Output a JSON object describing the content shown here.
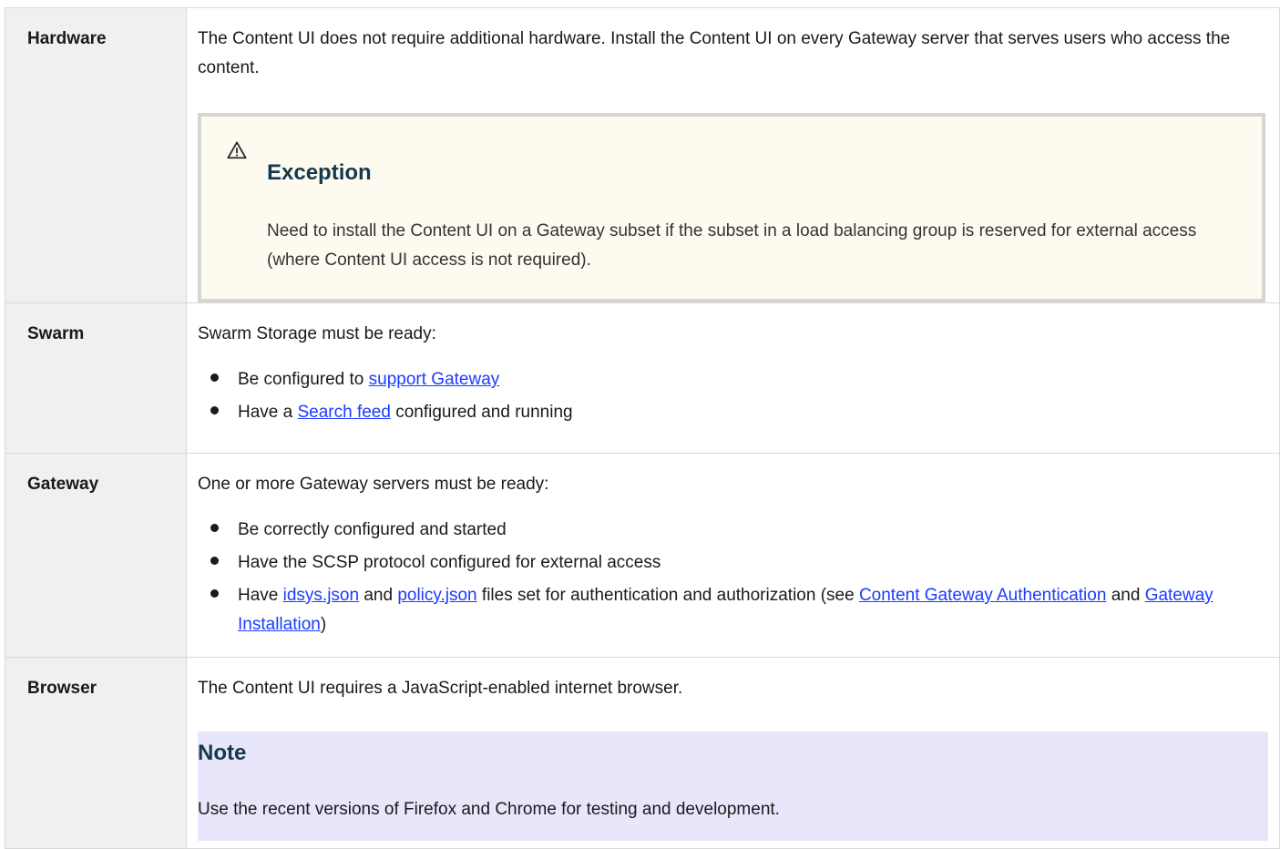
{
  "rows": [
    {
      "label": "Hardware",
      "text": "The Content UI does not require additional hardware. Install the Content UI on every Gateway server that serves users who access the content.",
      "callout": {
        "icon": "warning-icon",
        "title": "Exception",
        "body": "Need to install the Content UI on a Gateway subset if the subset in a load balancing group is reserved for external access (where Content UI access is not required)."
      }
    },
    {
      "label": "Swarm",
      "intro": "Swarm Storage must be ready:",
      "bullets": [
        {
          "pre": "Be configured to ",
          "link": "support Gateway",
          "post": ""
        },
        {
          "pre": "Have a ",
          "link": "Search feed",
          "post": " configured and running"
        }
      ]
    },
    {
      "label": "Gateway",
      "intro": "One or more Gateway servers must be ready:",
      "bullets": [
        {
          "text": "Be correctly configured and started"
        },
        {
          "text": "Have the SCSP protocol configured for external access"
        },
        {
          "pre": "Have ",
          "link1": "idsys.json",
          "mid1": " and ",
          "link2": "policy.json",
          "mid2": " files set for authentication and authorization (see ",
          "link3": "Content Gateway Authentication",
          "mid3": " and ",
          "link4": "Gateway Installation",
          "post": ")"
        }
      ]
    },
    {
      "label": "Browser",
      "text": "The Content UI requires a JavaScript-enabled internet browser.",
      "note": {
        "title": "Note",
        "body": "Use the recent versions of Firefox and Chrome for testing and development."
      }
    }
  ],
  "colors": {
    "label_bg": "#f0f0f0",
    "border": "#d9d9d9",
    "link": "#1a3cff",
    "callout_bg": "#fdfbef",
    "note_bg": "#e8e6fb",
    "heading": "#16384d"
  }
}
